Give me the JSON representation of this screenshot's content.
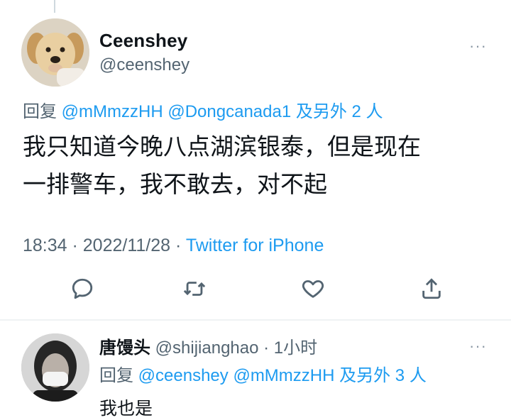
{
  "tweet": {
    "display_name": "Ceenshey",
    "handle": "@ceenshey",
    "more": "···",
    "reply_prefix": "回复 ",
    "reply_mention_1": "@mMmzzHH",
    "reply_mention_2": "@Dongcanada1",
    "reply_others": " 及另外 2 人",
    "text_line_1": "我只知道今晚八点湖滨银泰，但是现在",
    "text_line_2": "一排警车，我不敢去，对不起",
    "time": "18:34 · 2022/11/28 · ",
    "source": "Twitter for iPhone"
  },
  "actions": {
    "reply_icon": "comment-icon",
    "retweet_icon": "retweet-icon",
    "like_icon": "heart-icon",
    "share_icon": "share-icon"
  },
  "reply": {
    "display_name": "唐馒头",
    "handle": " @shijianghao",
    "time": " · 1小时",
    "more": "···",
    "reply_prefix": "回复 ",
    "reply_mention_1": "@ceenshey",
    "reply_mention_2": "@mMmzzHH",
    "reply_others": " 及另外 3 人",
    "text": "我也是"
  },
  "colors": {
    "link": "#1d9bf0",
    "secondary_text": "#536471",
    "primary_text": "#0f1419",
    "icon": "#536471"
  }
}
